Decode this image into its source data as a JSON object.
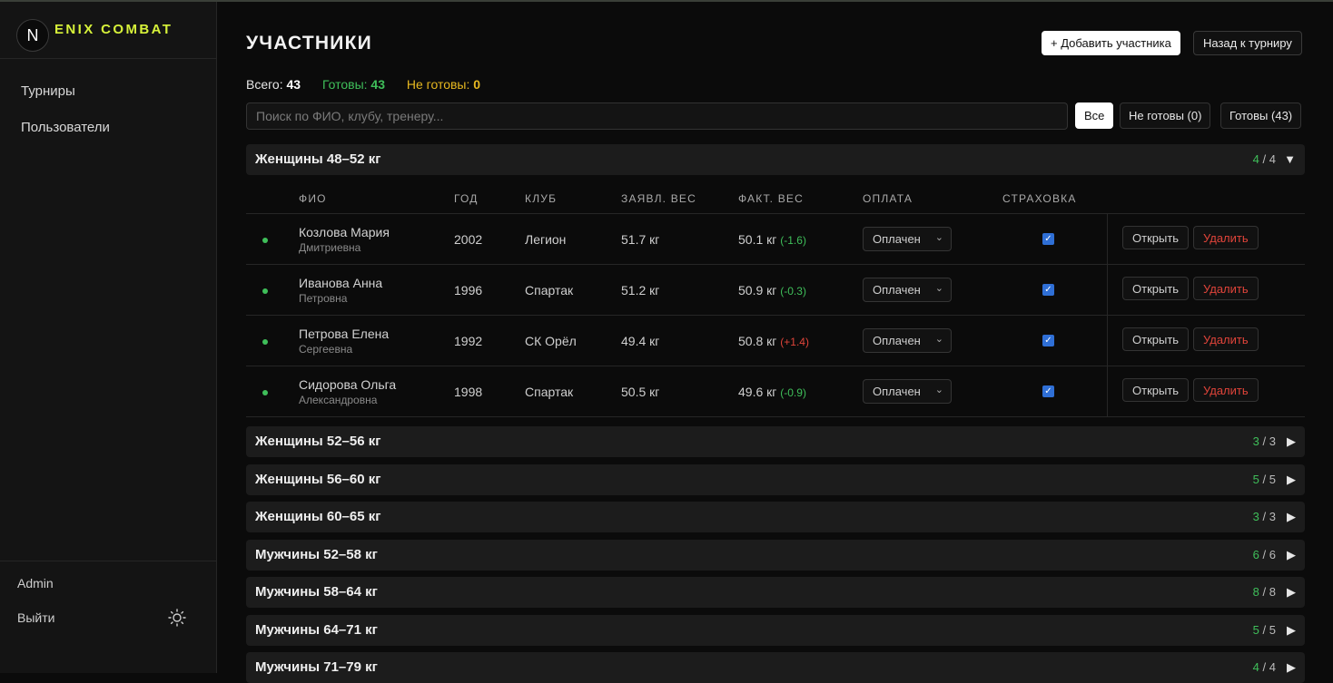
{
  "sidebar": {
    "brand": "ENIX COMBAT",
    "logo_letter": "N",
    "nav": [
      "Турниры",
      "Пользователи"
    ],
    "user": "Admin",
    "logout": "Выйти"
  },
  "header": {
    "title": "УЧАСТНИКИ",
    "add_button": "+ Добавить участника",
    "back_button": "Назад к турниру"
  },
  "stats": {
    "total_label": "Всего:",
    "total_value": "43",
    "ready_label": "Готовы:",
    "ready_value": "43",
    "notready_label": "Не готовы:",
    "notready_value": "0"
  },
  "search": {
    "placeholder": "Поиск по ФИО, клубу, тренеру..."
  },
  "filters": [
    "Все",
    "Не готовы (0)",
    "Готовы (43)"
  ],
  "table_headers": [
    "ФИО",
    "ГОД",
    "КЛУБ",
    "ЗАЯВЛ. ВЕС",
    "ФАКТ. ВЕС",
    "ОПЛАТА",
    "СТРАХОВКА"
  ],
  "groups": [
    {
      "title": "Женщины 48–52 кг",
      "ready": "4",
      "total": "/ 4",
      "arrow": "▼"
    },
    {
      "title": "Женщины 52–56 кг",
      "ready": "3",
      "total": "/ 3",
      "arrow": "▶"
    },
    {
      "title": "Женщины 56–60 кг",
      "ready": "5",
      "total": "/ 5",
      "arrow": "▶"
    },
    {
      "title": "Женщины 60–65 кг",
      "ready": "3",
      "total": "/ 3",
      "arrow": "▶"
    },
    {
      "title": "Мужчины 52–58 кг",
      "ready": "6",
      "total": "/ 6",
      "arrow": "▶"
    },
    {
      "title": "Мужчины 58–64 кг",
      "ready": "8",
      "total": "/ 8",
      "arrow": "▶"
    },
    {
      "title": "Мужчины 64–71 кг",
      "ready": "5",
      "total": "/ 5",
      "arrow": "▶"
    },
    {
      "title": "Мужчины 71–79 кг",
      "ready": "4",
      "total": "/ 4",
      "arrow": "▶"
    }
  ],
  "rows": [
    {
      "name": "Козлова Мария",
      "patronymic": "Дмитриевна",
      "year": "2002",
      "club": "Легион",
      "declared": "51.7 кг",
      "actual": "50.1 кг",
      "diff": "(-1.6)",
      "diff_color": "green",
      "payment": "Оплачен",
      "open": "Открыть",
      "delete": "Удалить"
    },
    {
      "name": "Иванова Анна",
      "patronymic": "Петровна",
      "year": "1996",
      "club": "Спартак",
      "declared": "51.2 кг",
      "actual": "50.9 кг",
      "diff": "(-0.3)",
      "diff_color": "green",
      "payment": "Оплачен",
      "open": "Открыть",
      "delete": "Удалить"
    },
    {
      "name": "Петрова Елена",
      "patronymic": "Сергеевна",
      "year": "1992",
      "club": "СК Орёл",
      "declared": "49.4 кг",
      "actual": "50.8 кг",
      "diff": "(+1.4)",
      "diff_color": "red",
      "payment": "Оплачен",
      "open": "Открыть",
      "delete": "Удалить"
    },
    {
      "name": "Сидорова Ольга",
      "patronymic": "Александровна",
      "year": "1998",
      "club": "Спартак",
      "declared": "50.5 кг",
      "actual": "49.6 кг",
      "diff": "(-0.9)",
      "diff_color": "green",
      "payment": "Оплачен",
      "open": "Открыть",
      "delete": "Удалить"
    }
  ],
  "colors": {
    "accent_brand": "#d7f23a",
    "ready": "#3fbf5a",
    "notready": "#e6b820",
    "danger": "#e0443a",
    "checkbox": "#2f6fd6"
  },
  "icons": {
    "theme_toggle": "sun-icon",
    "expand": "triangle-down-icon",
    "collapse": "triangle-right-icon",
    "select": "chevron-down-icon"
  }
}
